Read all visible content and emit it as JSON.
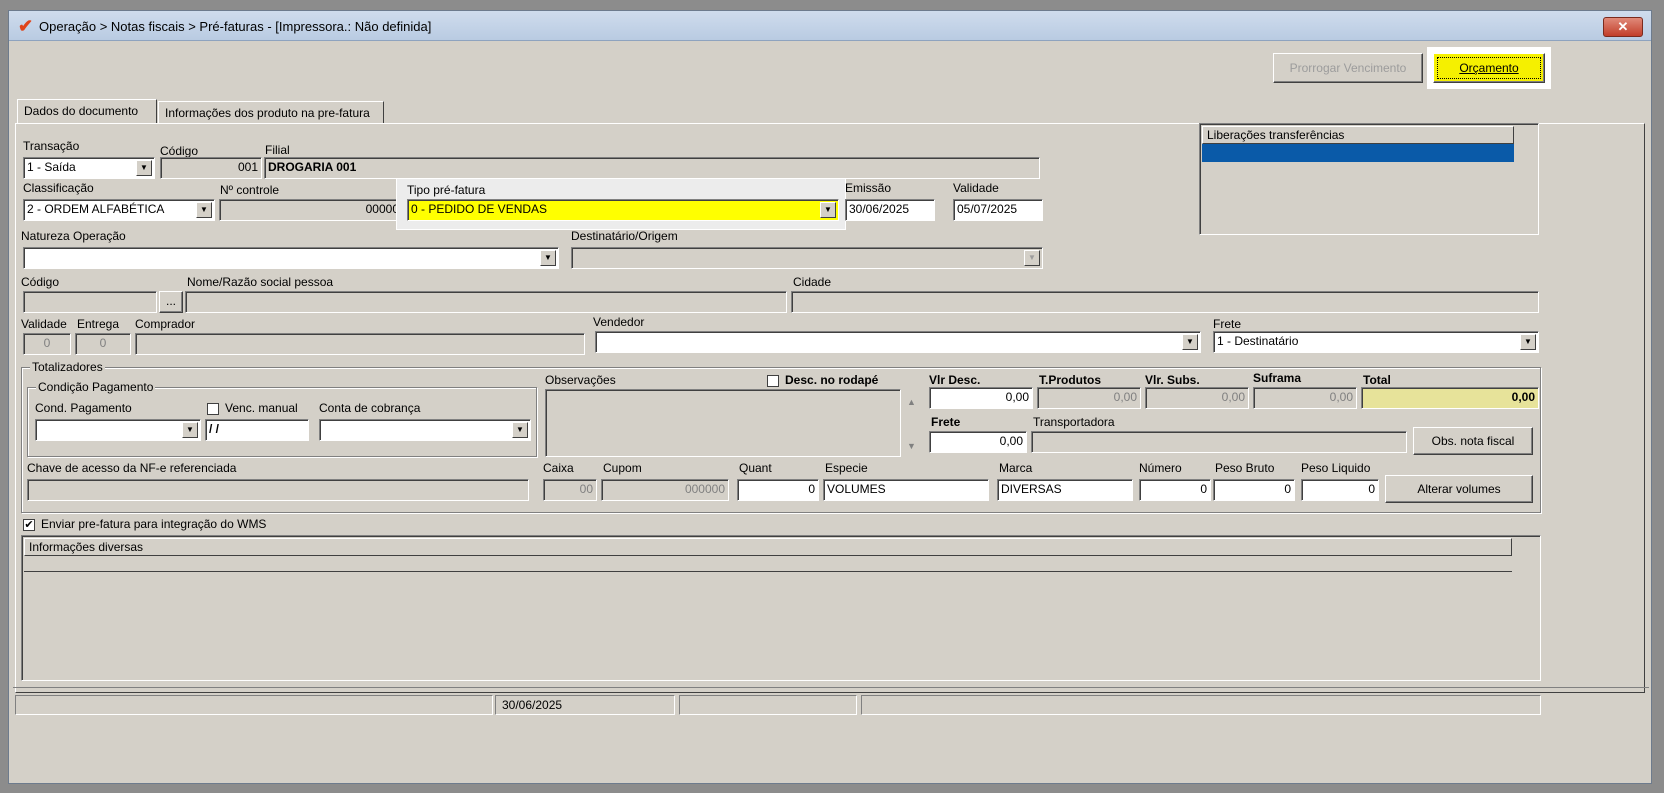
{
  "window": {
    "title": "Operação > Notas fiscais > Pré-faturas - [Impressora.: Não definida]",
    "close_label": "✕"
  },
  "toolbar": {
    "prorrogar_label": "Prorrogar Vencimento",
    "orcamento_label": "Orçamento"
  },
  "tabs": [
    {
      "label": "Dados do documento"
    },
    {
      "label": "Informações dos produto na pre-fatura"
    }
  ],
  "form": {
    "transacao": {
      "label": "Transação",
      "value": "1 - Saída"
    },
    "codigo": {
      "label": "Código",
      "value": "001"
    },
    "filial": {
      "label": "Filial",
      "value": "DROGARIA 001"
    },
    "classificacao": {
      "label": "Classificação",
      "value": "2 - ORDEM ALFABÉTICA"
    },
    "nr_controle": {
      "label": "Nº controle",
      "value": "00000"
    },
    "tipo_prefatura": {
      "label": "Tipo pré-fatura",
      "value": "0  - PEDIDO DE VENDAS"
    },
    "emissao": {
      "label": "Emissão",
      "value": "30/06/2025"
    },
    "validade": {
      "label": "Validade",
      "value": "05/07/2025"
    },
    "natureza_operacao": {
      "label": "Natureza  Operação",
      "value": ""
    },
    "destinatario_origem": {
      "label": "Destinatário/Origem",
      "value": ""
    },
    "pessoa_codigo": {
      "label": "Código",
      "value": "",
      "lookup_label": "..."
    },
    "nome_razao": {
      "label": "Nome/Razão social pessoa",
      "value": ""
    },
    "cidade": {
      "label": "Cidade",
      "value": ""
    },
    "validade_dias": {
      "label": "Validade",
      "value": "0"
    },
    "entrega": {
      "label": "Entrega",
      "value": "0"
    },
    "comprador": {
      "label": "Comprador",
      "value": ""
    },
    "vendedor": {
      "label": "Vendedor",
      "value": ""
    },
    "frete": {
      "label": "Frete",
      "value": "1 - Destinatário"
    }
  },
  "liberacoes": {
    "header": "Liberações transferências"
  },
  "totalizadores": {
    "title": "Totalizadores",
    "condicao": {
      "title": "Condição Pagamento",
      "cond_label": "Cond. Pagamento",
      "venc_manual_label": "Venc. manual",
      "venc_value": "/ /",
      "conta_label": "Conta de cobrança"
    },
    "observacoes_label": "Observações",
    "desc_rodape_label": "Desc. no rodapé",
    "vlr_desc": {
      "label": "Vlr Desc.",
      "value": "0,00"
    },
    "t_produtos": {
      "label": "T.Produtos",
      "value": "0,00"
    },
    "vlr_subs": {
      "label": "Vlr. Subs.",
      "value": "0,00"
    },
    "suframa": {
      "label": "Suframa",
      "value": "0,00"
    },
    "total": {
      "label": "Total",
      "value": "0,00"
    },
    "frete": {
      "label": "Frete",
      "value": "0,00"
    },
    "transportadora_label": "Transportadora",
    "obs_nota_label": "Obs. nota fiscal",
    "chave_label": "Chave de acesso da NF-e referenciada",
    "caixa": {
      "label": "Caixa",
      "value": "00"
    },
    "cupom": {
      "label": "Cupom",
      "value": "000000"
    },
    "quant": {
      "label": "Quant",
      "value": "0"
    },
    "especie": {
      "label": "Especie",
      "value": "VOLUMES"
    },
    "marca": {
      "label": "Marca",
      "value": "DIVERSAS"
    },
    "numero": {
      "label": "Número",
      "value": "0"
    },
    "peso_bruto": {
      "label": "Peso Bruto",
      "value": "0"
    },
    "peso_liquido": {
      "label": "Peso Liquido",
      "value": "0"
    },
    "alterar_volumes_label": "Alterar volumes"
  },
  "wms": {
    "label": "Enviar pre-fatura para integração do WMS",
    "checked": "✔"
  },
  "info_diversas": {
    "header": "Informações diversas"
  },
  "status": {
    "date": "30/06/2025"
  },
  "colors": {
    "highlight_yellow": "#ffff00",
    "selected_blue": "#0a5aa8"
  }
}
